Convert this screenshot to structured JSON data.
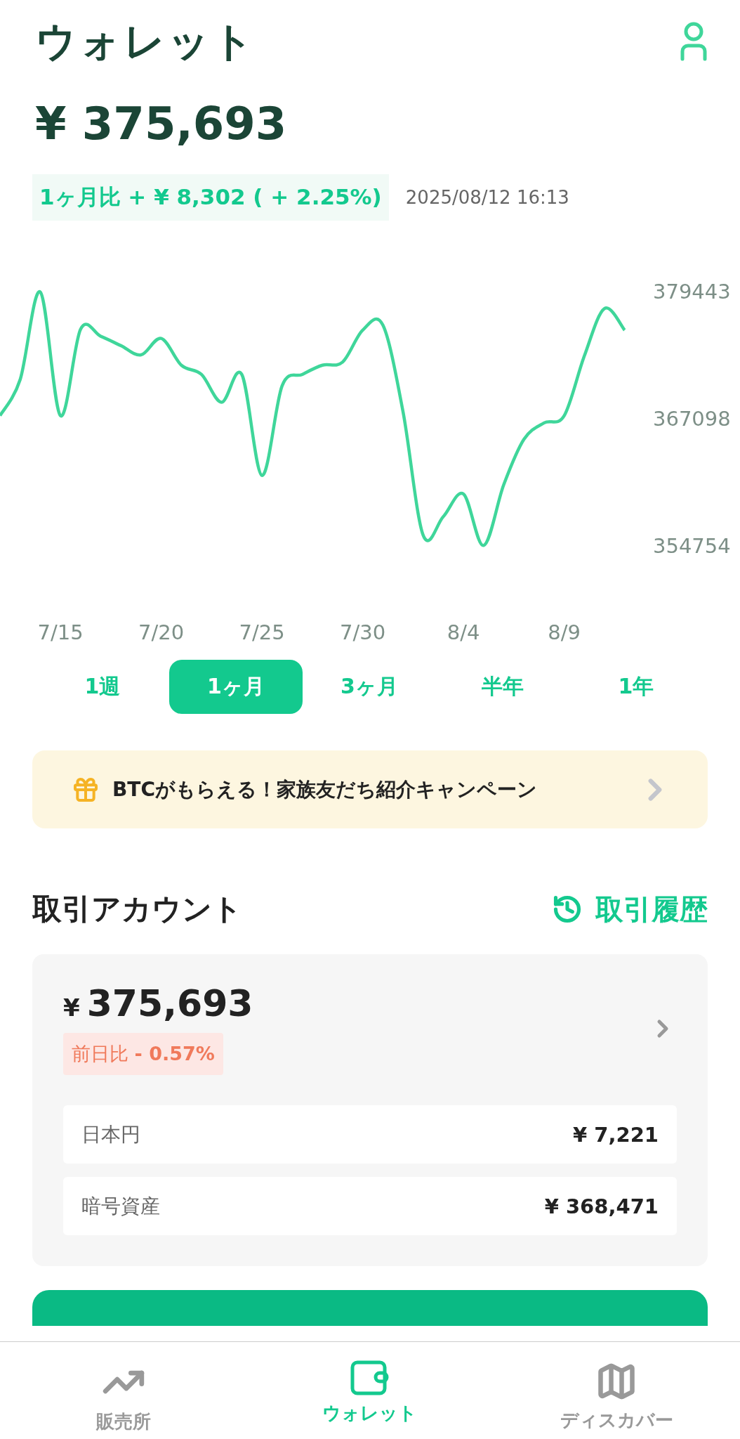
{
  "header": {
    "title": "ウォレット"
  },
  "balance": {
    "amount": "¥ 375,693",
    "change": "1ヶ月比 + ¥ 8,302 ( + 2.25%)",
    "timestamp": "2025/08/12 16:13"
  },
  "chart_data": {
    "type": "line",
    "categories": [
      null,
      null,
      null,
      "7/15",
      null,
      null,
      null,
      null,
      "7/20",
      null,
      null,
      null,
      null,
      "7/25",
      null,
      null,
      null,
      null,
      "7/30",
      null,
      null,
      null,
      null,
      "8/4",
      null,
      null,
      null,
      null,
      "8/9",
      null,
      null,
      null
    ],
    "series": [
      {
        "color": "#3fd69a",
        "values": [
          367400,
          370900,
          379400,
          367400,
          375800,
          375100,
          374200,
          373300,
          374900,
          372300,
          371400,
          368700,
          371400,
          361600,
          370300,
          371400,
          372300,
          372600,
          375700,
          376200,
          367800,
          355800,
          357600,
          359800,
          354800,
          360700,
          365100,
          366700,
          367400,
          373200,
          377800,
          375700
        ]
      }
    ],
    "ylim": [
      354754,
      379443
    ],
    "yticks": [
      354754,
      367098,
      379443
    ]
  },
  "periods": [
    {
      "label": "1週",
      "selected": false
    },
    {
      "label": "1ヶ月",
      "selected": true
    },
    {
      "label": "3ヶ月",
      "selected": false
    },
    {
      "label": "半年",
      "selected": false
    },
    {
      "label": "1年",
      "selected": false
    }
  ],
  "banner": {
    "text": "BTCがもらえる！家族友だち紹介キャンペーン"
  },
  "account": {
    "title": "取引アカウント",
    "history_link": "取引履歴",
    "currency": "¥",
    "amount": "375,693",
    "daily_change": "前日比 **- 0.57%**",
    "rows": [
      {
        "label": "日本円",
        "value": "¥ 7,221"
      },
      {
        "label": "暗号資産",
        "value": "¥ 368,471"
      }
    ]
  },
  "action_button": {
    "kind": "primary"
  },
  "nav": [
    {
      "label": "販売所",
      "selected": false
    },
    {
      "label": "ウォレット",
      "selected": true
    },
    {
      "label": "ディスカバー",
      "selected": false
    }
  ]
}
